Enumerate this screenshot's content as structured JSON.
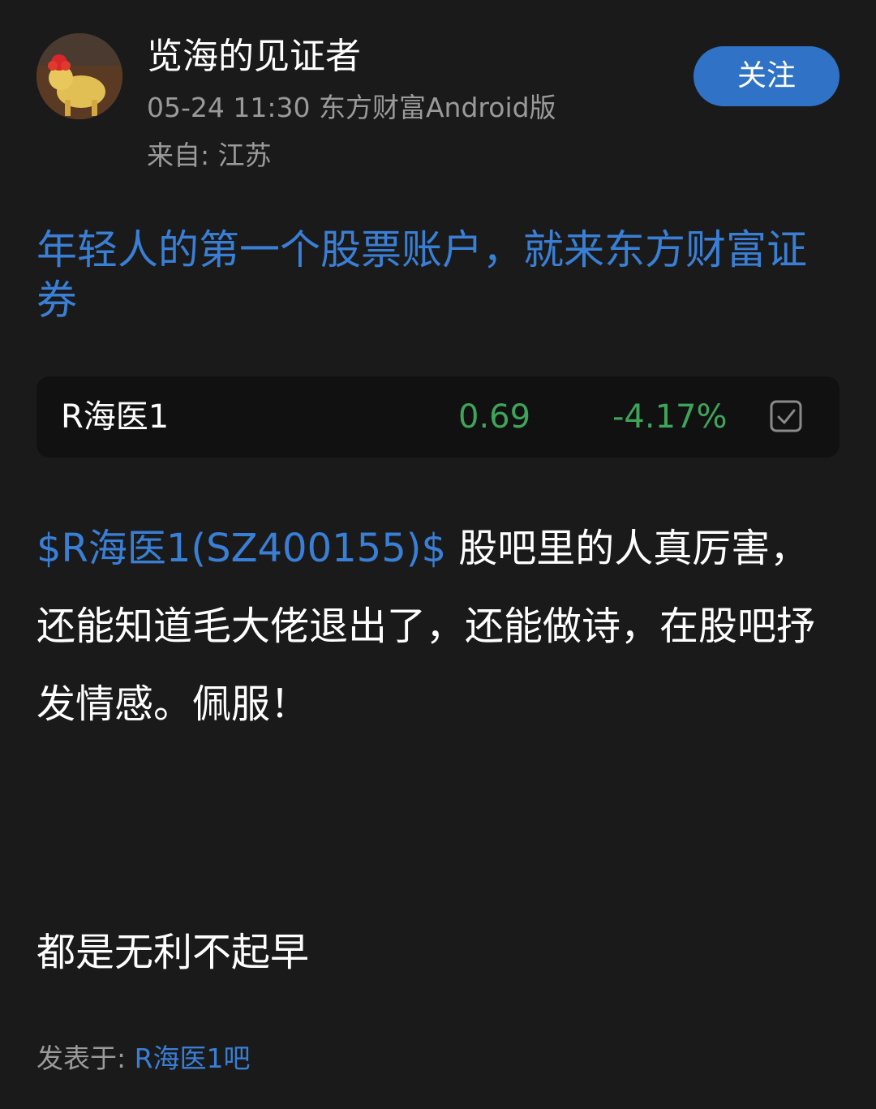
{
  "author": {
    "name": "览海的见证者",
    "meta": "05-24 11:30 东方财富Android版",
    "location": "来自: 江苏"
  },
  "follow_button": {
    "label": "关注",
    "color": "#2f72c6"
  },
  "promo": {
    "text": "年轻人的第一个股票账户，就来东方财富证券"
  },
  "stock_card": {
    "name": "R海医1",
    "price": "0.69",
    "change": "-4.17%",
    "change_color": "#3fa45b",
    "action_icon": "checkbox-checked-icon"
  },
  "post": {
    "tag": "$R海医1(SZ400155)$",
    "body": " 股吧里的人真厉害，还能知道毛大佬退出了，还能做诗，在股吧抒发情感。佩服！",
    "extra_line": "都是无利不起早"
  },
  "footer": {
    "published_label": "发表于: ",
    "bar_name": "R海医1吧"
  },
  "colors": {
    "background": "#1a1a1a",
    "link_blue": "#3a7fd6",
    "muted_text": "#9a9a9a"
  }
}
